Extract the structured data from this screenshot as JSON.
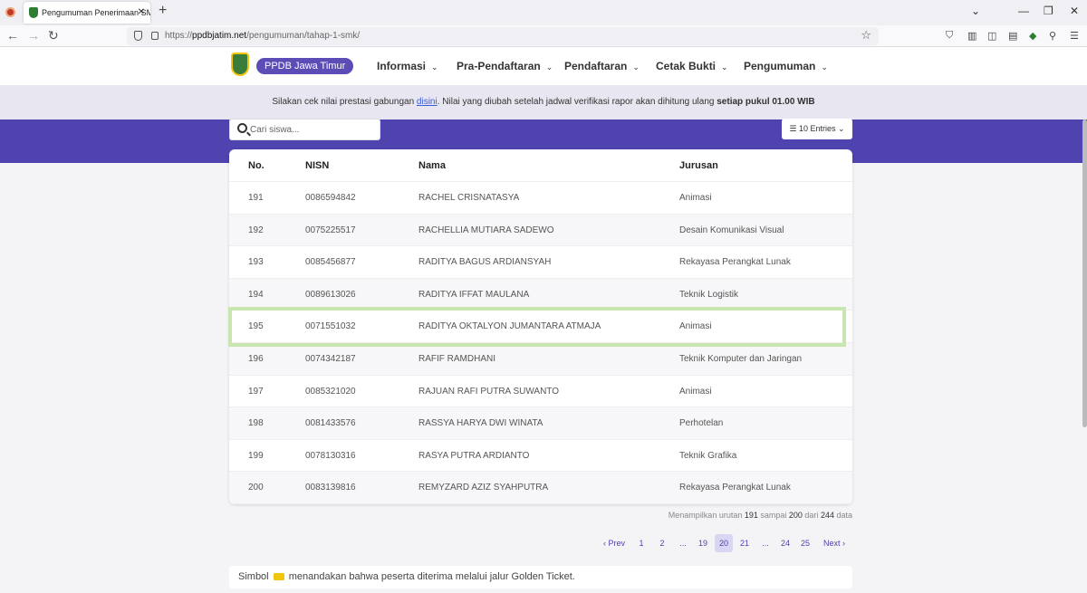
{
  "browser": {
    "tab_title": "Pengumuman Penerimaan SMK",
    "tab_close": "✕",
    "url_prefix": "https://",
    "url_host": "ppdbjatim.net",
    "url_path": "/pengumuman/tahap-1-smk/"
  },
  "header": {
    "brand": "PPDB Jawa Timur",
    "menu": [
      "Informasi",
      "Pra-Pendaftaran",
      "Pendaftaran",
      "Cetak Bukti",
      "Pengumuman"
    ]
  },
  "notice": {
    "before": "Silakan cek nilai prestasi gabungan ",
    "link": "disini",
    "after": ". Nilai yang diubah setelah jadwal verifikasi rapor akan dihitung ulang ",
    "bold": "setiap pukul 01.00 WIB"
  },
  "search": {
    "placeholder": "Cari siswa..."
  },
  "entries": {
    "label": "10 Entries"
  },
  "table": {
    "headers": [
      "No.",
      "NISN",
      "Nama",
      "Jurusan"
    ],
    "rows": [
      [
        "191",
        "0086594842",
        "RACHEL CRISNATASYA",
        "Animasi"
      ],
      [
        "192",
        "0075225517",
        "RACHELLIA MUTIARA SADEWO",
        "Desain Komunikasi Visual"
      ],
      [
        "193",
        "0085456877",
        "RADITYA BAGUS ARDIANSYAH",
        "Rekayasa Perangkat Lunak"
      ],
      [
        "194",
        "0089613026",
        "RADITYA IFFAT MAULANA",
        "Teknik Logistik"
      ],
      [
        "195",
        "0071551032",
        "RADITYA OKTALYON JUMANTARA ATMAJA",
        "Animasi"
      ],
      [
        "196",
        "0074342187",
        "RAFIF RAMDHANI",
        "Teknik Komputer dan Jaringan"
      ],
      [
        "197",
        "0085321020",
        "RAJUAN RAFI PUTRA SUWANTO",
        "Animasi"
      ],
      [
        "198",
        "0081433576",
        "RASSYA HARYA DWI WINATA",
        "Perhotelan"
      ],
      [
        "199",
        "0078130316",
        "RASYA PUTRA ARDIANTO",
        "Teknik Grafika"
      ],
      [
        "200",
        "0083139816",
        "REMYZARD AZIZ SYAHPUTRA",
        "Rekayasa Perangkat Lunak"
      ]
    ]
  },
  "info": {
    "prefix": "Menampilkan urutan ",
    "from": "191",
    "mid1": " sampai ",
    "to": "200",
    "mid2": " dari ",
    "total": "244",
    "suffix": " data"
  },
  "pagination": {
    "prev": "Prev",
    "next": "Next",
    "pages": [
      "1",
      "2",
      "...",
      "19",
      "20",
      "21",
      "...",
      "24",
      "25"
    ],
    "active": "20"
  },
  "footer": {
    "before": "Simbol ",
    "after": " menandakan bahwa peserta diterima melalui jalur Golden Ticket."
  },
  "colors": {
    "brand": "#4f43b0",
    "highlight": "#c8e6b0"
  }
}
